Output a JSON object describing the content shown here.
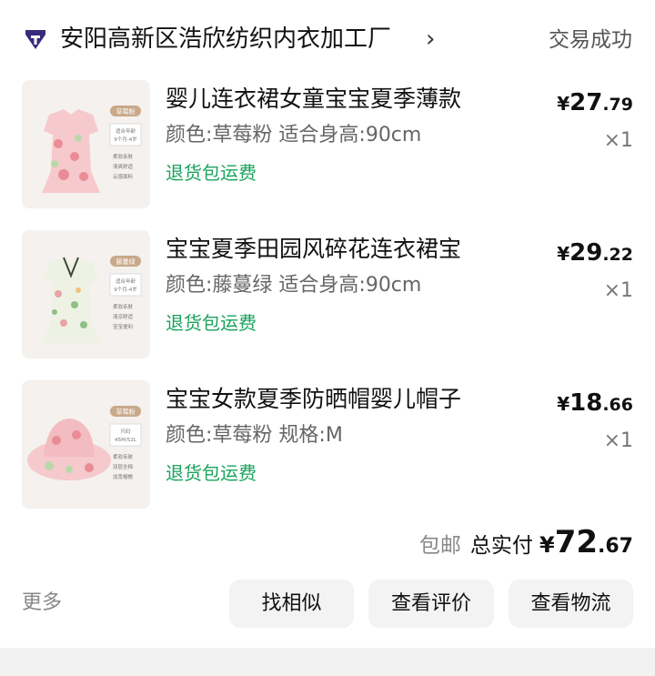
{
  "shop": {
    "name": "安阳高新区浩欣纺织内衣加工厂",
    "chevron": "›",
    "status": "交易成功",
    "logo_icon": "taobao-shop-diamond-icon",
    "logo_color": "#3a2a7a"
  },
  "items": [
    {
      "title": "婴儿连衣裙女童宝宝夏季薄款",
      "spec": "颜色:草莓粉 适合身高:90cm",
      "tag": "退货包运费",
      "price_yen": "¥",
      "price_int": "27",
      "price_dec": ".79",
      "qty": "×1",
      "thumb_icon": "pink-baby-dress-image",
      "thumb_badge": "草莓粉",
      "thumb_lines": [
        "适合年龄",
        "9个月-4岁"
      ],
      "thumb_bullets": [
        "柔软亲肤",
        "清爽舒适",
        "云感面料"
      ]
    },
    {
      "title": "宝宝夏季田园风碎花连衣裙宝",
      "spec": "颜色:藤蔓绿 适合身高:90cm",
      "tag": "退货包运费",
      "price_yen": "¥",
      "price_int": "29",
      "price_dec": ".22",
      "qty": "×1",
      "thumb_icon": "green-floral-dress-image",
      "thumb_badge": "藤蔓绿",
      "thumb_lines": [
        "适合年龄",
        "9个月-4岁"
      ],
      "thumb_bullets": [
        "柔软亲肤",
        "清凉舒适",
        "宝宝便利"
      ]
    },
    {
      "title": "宝宝女款夏季防晒帽婴儿帽子",
      "spec": "颜色:草莓粉 规格:M",
      "tag": "退货包运费",
      "price_yen": "¥",
      "price_int": "18",
      "price_dec": ".66",
      "qty": "×1",
      "thumb_icon": "pink-sun-hat-image",
      "thumb_badge": "草莓粉",
      "thumb_lines": [
        "尺码",
        "45M/52L"
      ],
      "thumb_bullets": [
        "柔软亲肤",
        "双层全棉",
        "加宽帽檐"
      ]
    }
  ],
  "total": {
    "free_shipping": "包邮",
    "label": "总实付",
    "yen": "¥",
    "int": "72",
    "dec": ".67"
  },
  "actions": {
    "more": "更多",
    "find_similar": "找相似",
    "view_review": "查看评价",
    "view_logistics": "查看物流"
  },
  "colors": {
    "tag_green": "#1aa35c",
    "button_bg": "#f3f3f3",
    "muted_text": "#888888"
  }
}
